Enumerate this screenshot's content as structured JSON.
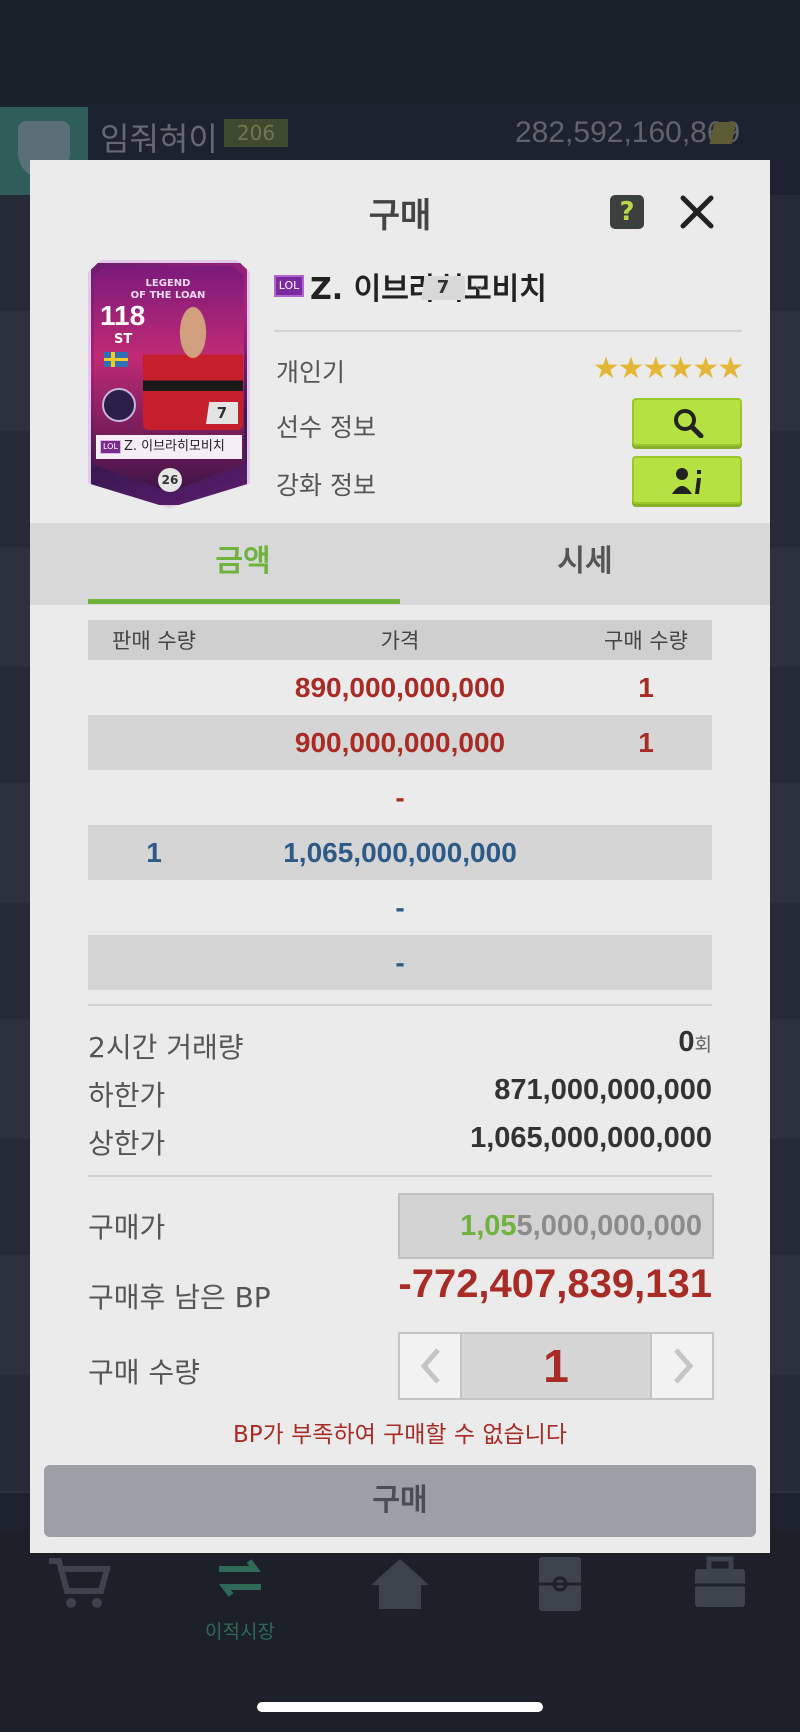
{
  "background": {
    "username": "임줘혀이",
    "level": "206",
    "bp_balance": "282,592,160,869",
    "nav": [
      {
        "label": "",
        "icon": "cart-icon"
      },
      {
        "label": "이적시장",
        "icon": "transfer-icon"
      },
      {
        "label": "",
        "icon": "home-icon"
      },
      {
        "label": "",
        "icon": "pitch-icon"
      },
      {
        "label": "",
        "icon": "briefcase-icon"
      }
    ]
  },
  "modal": {
    "title": "구매",
    "help_label": "?",
    "card": {
      "title_line1": "LEGEND",
      "title_line2": "OF THE LOAN",
      "ovr": "118",
      "position": "ST",
      "grade": "7",
      "name": "Z. 이브라히모비치",
      "season_tag": "LOL",
      "number": "26"
    },
    "player": {
      "season_tag": "LOL",
      "name": "Z. 이브라히모비치",
      "grade": "7",
      "chevron": "⌵"
    },
    "info": {
      "popularity_label": "개인기",
      "popularity_stars": "★★★★★★",
      "player_info_label": "선수 정보",
      "enhance_info_label": "강화 정보"
    },
    "tabs": [
      {
        "label": "금액",
        "active": true
      },
      {
        "label": "시세",
        "active": false
      }
    ],
    "order_table": {
      "headers": [
        "판매 수량",
        "가격",
        "구매 수량"
      ],
      "rows": [
        {
          "sell_qty": "",
          "price": "890,000,000,000",
          "buy_qty": "1"
        },
        {
          "sell_qty": "",
          "price": "900,000,000,000",
          "buy_qty": "1"
        },
        {
          "sell_qty": "",
          "price": "-",
          "buy_qty": ""
        },
        {
          "sell_qty": "1",
          "price": "1,065,000,000,000",
          "buy_qty": ""
        },
        {
          "sell_qty": "",
          "price": "-",
          "buy_qty": ""
        },
        {
          "sell_qty": "",
          "price": "-",
          "buy_qty": ""
        }
      ]
    },
    "stats": {
      "volume_label": "2시간 거래량",
      "volume_value": "0",
      "volume_unit": "회",
      "lower_label": "하한가",
      "lower_value": "871,000,000,000",
      "upper_label": "상한가",
      "upper_value": "1,065,000,000,000"
    },
    "purchase": {
      "price_label": "구매가",
      "price_highlight": "1,05",
      "price_rest": "5,000,000,000",
      "remain_label": "구매후 남은 BP",
      "remain_value": "-772,407,839,131",
      "qty_label": "구매 수량",
      "qty_value": "1",
      "error": "BP가 부족하여 구매할 수 없습니다",
      "buy_button": "구매"
    }
  },
  "colors": {
    "accent_green": "#6eb33d",
    "button_green": "#b5e242",
    "sell_red": "#a82b25",
    "buy_blue": "#2d5a87",
    "modal_bg": "#ebebeb"
  }
}
